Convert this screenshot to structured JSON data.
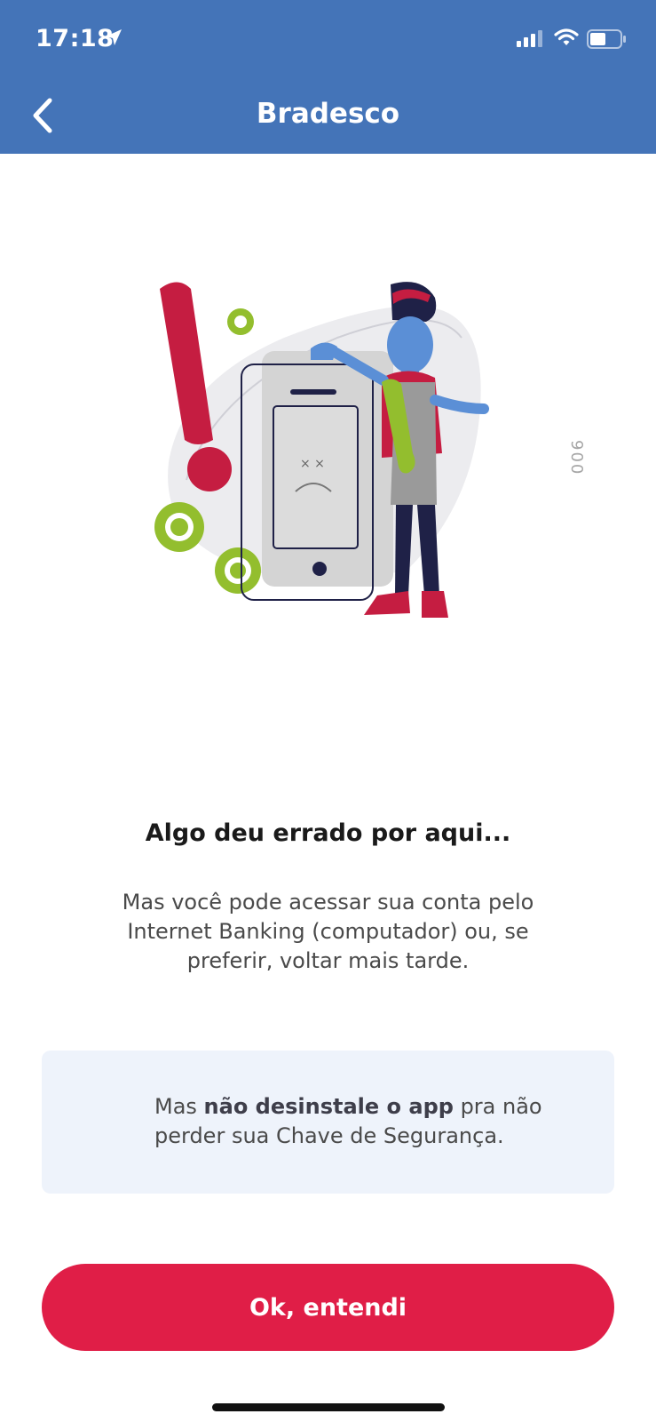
{
  "status_bar": {
    "time": "17:18"
  },
  "nav": {
    "title": "Bradesco"
  },
  "illustration": {
    "side_code": "900"
  },
  "error": {
    "title": "Algo deu errado por aqui...",
    "message": "Mas você pode acessar sua conta pelo Internet Banking (computador) ou, se preferir, voltar mais tarde."
  },
  "notice": {
    "prefix": "Mas ",
    "bold": "não desinstale o app",
    "suffix": " pra não perder sua Chave de Segurança."
  },
  "actions": {
    "ok_label": "Ok, entendi"
  },
  "colors": {
    "header": "#4474b8",
    "primary_button": "#e01e47",
    "notice_bg": "#eef3fb"
  }
}
